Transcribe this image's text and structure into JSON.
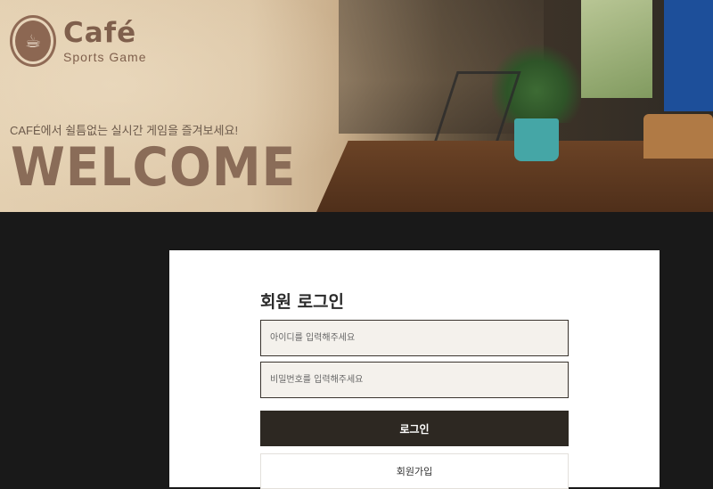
{
  "brand": {
    "logo_title": "Café",
    "logo_subtitle": "Sports Game",
    "logo_icon": "coffee-cup-icon"
  },
  "hero": {
    "tagline": "CAFÉ에서 쉴틈없는 실시간 게임을 즐겨보세요!",
    "headline": "WELCOME"
  },
  "login": {
    "title": "회원 로그인",
    "id_placeholder": "아이디를 입력해주세요",
    "password_placeholder": "비밀번호를 입력해주세요",
    "id_value": "",
    "password_value": "",
    "login_button": "로그인",
    "signup_button": "회원가입"
  },
  "colors": {
    "brand_brown": "#7f5f4c",
    "page_background": "#191919",
    "login_button_bg": "#2d2822",
    "input_bg": "#f4f1ec"
  }
}
